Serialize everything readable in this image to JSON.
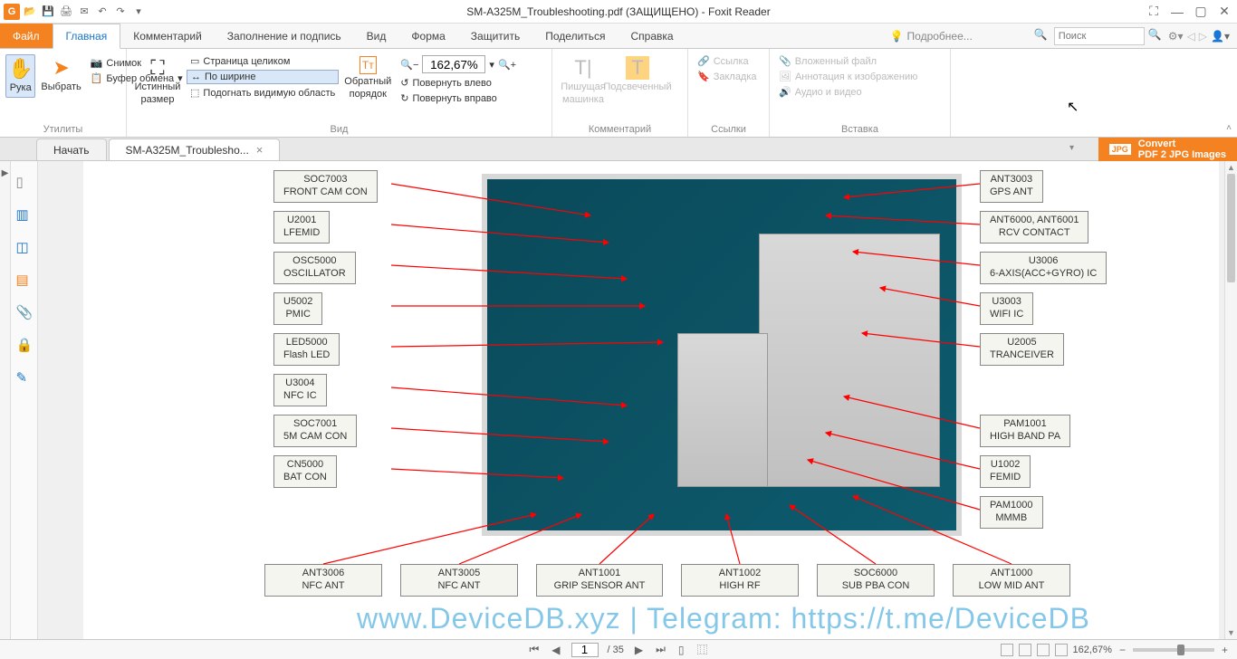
{
  "title": "SM-A325M_Troubleshooting.pdf (ЗАЩИЩЕНО) - Foxit Reader",
  "menu": {
    "file": "Файл",
    "tabs": [
      "Главная",
      "Комментарий",
      "Заполнение и подпись",
      "Вид",
      "Форма",
      "Защитить",
      "Поделиться",
      "Справка"
    ],
    "learn_more": "Подробнее...",
    "search_placeholder": "Поиск"
  },
  "ribbon": {
    "tools": {
      "hand": "Рука",
      "select": "Выбрать",
      "snapshot": "Снимок",
      "clipboard": "Буфер обмена",
      "label": "Утилиты"
    },
    "view": {
      "actual_size": "Истинный размер",
      "full_page": "Страница целиком",
      "fit_width": "По ширине",
      "fit_visible": "Подогнать видимую область",
      "reflow": "Обратный порядок",
      "zoom_value": "162,67%",
      "rotate_left": "Повернуть влево",
      "rotate_right": "Повернуть вправо",
      "label": "Вид"
    },
    "comment": {
      "typewriter": "Пишущая машинка",
      "highlight": "Подсвеченный",
      "label": "Комментарий"
    },
    "links": {
      "link": "Ссылка",
      "bookmark": "Закладка",
      "label": "Ссылки"
    },
    "insert": {
      "attachment": "Вложенный файл",
      "image_annot": "Аннотация к изображению",
      "audio_video": "Аудио и видео",
      "label": "Вставка"
    }
  },
  "doctabs": {
    "start": "Начать",
    "doc": "SM-A325M_Troublesho...",
    "convert1": "Convert",
    "convert2": "PDF 2 JPG Images"
  },
  "labels_left": [
    {
      "l1": "SOC7003",
      "l2": "FRONT CAM CON"
    },
    {
      "l1": "U2001",
      "l2": "LFEMID"
    },
    {
      "l1": "OSC5000",
      "l2": "OSCILLATOR"
    },
    {
      "l1": "U5002",
      "l2": "PMIC"
    },
    {
      "l1": "LED5000",
      "l2": "Flash LED"
    },
    {
      "l1": "U3004",
      "l2": "NFC IC"
    },
    {
      "l1": "SOC7001",
      "l2": "5M CAM CON"
    },
    {
      "l1": "CN5000",
      "l2": "BAT CON"
    }
  ],
  "labels_right": [
    {
      "l1": "ANT3003",
      "l2": "GPS ANT"
    },
    {
      "l1": "ANT6000, ANT6001",
      "l2": "RCV CONTACT"
    },
    {
      "l1": "U3006",
      "l2": "6-AXIS(ACC+GYRO)  IC"
    },
    {
      "l1": "U3003",
      "l2": "WIFI IC"
    },
    {
      "l1": "U2005",
      "l2": "TRANCEIVER"
    },
    {
      "l1": "PAM1001",
      "l2": "HIGH BAND PA"
    },
    {
      "l1": "U1002",
      "l2": "FEMID"
    },
    {
      "l1": "PAM1000",
      "l2": "MMMB"
    }
  ],
  "labels_bottom": [
    {
      "l1": "ANT3006",
      "l2": "NFC ANT"
    },
    {
      "l1": "ANT3005",
      "l2": "NFC ANT"
    },
    {
      "l1": "ANT1001",
      "l2": "GRIP SENSOR ANT"
    },
    {
      "l1": "ANT1002",
      "l2": "HIGH RF"
    },
    {
      "l1": "SOC6000",
      "l2": "SUB PBA CON"
    },
    {
      "l1": "ANT1000",
      "l2": "LOW MID ANT"
    }
  ],
  "watermark": "www.DeviceDB.xyz | Telegram: https://t.me/DeviceDB",
  "status": {
    "page_current": "1",
    "page_total": "/ 35",
    "zoom": "162,67%"
  }
}
